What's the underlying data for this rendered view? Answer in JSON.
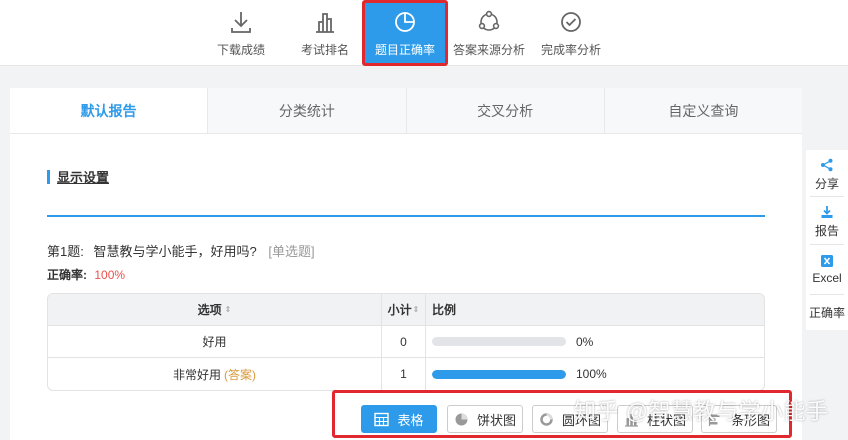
{
  "toolbar": {
    "items": [
      {
        "label": "下载成绩",
        "icon": "download-icon"
      },
      {
        "label": "考试排名",
        "icon": "bar-chart-icon"
      },
      {
        "label": "题目正确率",
        "icon": "pie-chart-icon",
        "active": true
      },
      {
        "label": "答案来源分析",
        "icon": "network-icon"
      },
      {
        "label": "完成率分析",
        "icon": "check-circle-icon"
      }
    ]
  },
  "tabs": [
    {
      "label": "默认报告",
      "active": true
    },
    {
      "label": "分类统计"
    },
    {
      "label": "交叉分析"
    },
    {
      "label": "自定义查询"
    }
  ],
  "settings_label": "显示设置",
  "question": {
    "number": "第1题:",
    "text": "智慧教与学小能手，好用吗?",
    "type": "[单选题]",
    "rate_label": "正确率:",
    "rate_value": "100%"
  },
  "table": {
    "headers": {
      "option": "选项",
      "count": "小计",
      "ratio": "比例"
    },
    "sort_glyph": "⇕",
    "rows": [
      {
        "option": "好用",
        "answer_tag": "",
        "count": "0",
        "ratio": 0,
        "ratio_text": "0%"
      },
      {
        "option": "非常好用",
        "answer_tag": "(答案)",
        "count": "1",
        "ratio": 100,
        "ratio_text": "100%"
      }
    ]
  },
  "chart_buttons": [
    {
      "label": "表格",
      "icon": "table-icon",
      "active": true
    },
    {
      "label": "饼状图",
      "icon": "pie-icon"
    },
    {
      "label": "圆环图",
      "icon": "donut-icon"
    },
    {
      "label": "柱状图",
      "icon": "column-icon"
    },
    {
      "label": "条形图",
      "icon": "bar-icon"
    }
  ],
  "sidebar": {
    "share": "分享",
    "report": "报告",
    "excel": "Excel",
    "rate": "正确率"
  },
  "watermark": "知乎 @智慧教与学小能手",
  "colors": {
    "accent": "#2e9bea",
    "highlight_border": "#e0282e",
    "rate": "#e8524d",
    "answer": "#d89a3c"
  }
}
